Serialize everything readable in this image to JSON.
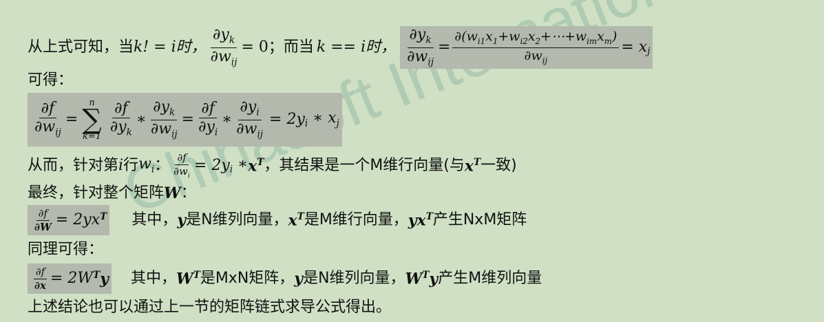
{
  "watermark": "Chinasoft International",
  "l1": {
    "prefix": "从上式可知，当",
    "cond1": "k! = i时，",
    "eq1": "= 0；而当",
    "cond2": "k == i时，",
    "rhs": "= x"
  },
  "l2": {
    "text": "可得："
  },
  "l3": {
    "k1": "k=1",
    "n": "n",
    "rhs": "= 2y"
  },
  "l4": {
    "prefix": "从而，针对第",
    "mid": "行",
    "eq": "= 2y",
    "suffix": "，其结果是一个M维行向量(与",
    "suffix2": "一致)"
  },
  "l5": {
    "text": "最终，针对整个矩阵",
    "W": "W",
    "colon": "："
  },
  "l6": {
    "eq": "= 2yx",
    "desc_a": "其中，",
    "desc_b": "是N维列向量，",
    "desc_c": "是M维行向量，",
    "desc_d": "产生NxM矩阵"
  },
  "l7": {
    "text": "同理可得："
  },
  "l8": {
    "eq": "= 2W",
    "desc_a": "其中，",
    "desc_b": "是MxN矩阵，",
    "desc_c": "是N维列向量，",
    "desc_d": "产生M维列向量"
  },
  "l9": {
    "text": "上述结论也可以通过上一节的矩阵链式求导公式得出。"
  }
}
